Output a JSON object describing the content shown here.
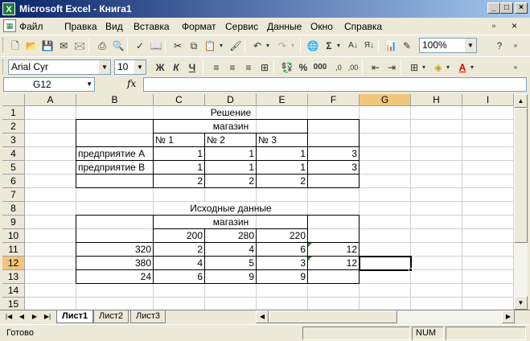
{
  "window": {
    "title": "Microsoft Excel - Книга1"
  },
  "menu": [
    "Файл",
    "Правка",
    "Вид",
    "Вставка",
    "Формат",
    "Сервис",
    "Данные",
    "Окно",
    "Справка"
  ],
  "toolbar": {
    "zoom": "100%",
    "font_name": "Arial Cyr",
    "font_size": "10",
    "sigma": "Σ",
    "bold": "Ж",
    "italic": "К",
    "underline": "Ч",
    "percent": "%",
    "thousands": "000"
  },
  "formula_bar": {
    "name_box": "G12",
    "fx": "fx",
    "content": ""
  },
  "columns": [
    "A",
    "B",
    "C",
    "D",
    "E",
    "F",
    "G",
    "H",
    "I"
  ],
  "rows": [
    "1",
    "2",
    "3",
    "4",
    "5",
    "6",
    "7",
    "8",
    "9",
    "10",
    "11",
    "12",
    "13",
    "14",
    "15"
  ],
  "cells": {
    "C1": "Решение",
    "C2": "магазин",
    "C3": "№ 1",
    "D3": "№ 2",
    "E3": "№ 3",
    "B4": "предприятие А",
    "C4": "1",
    "D4": "1",
    "E4": "1",
    "F4": "3",
    "B5": "предприятие В",
    "C5": "1",
    "D5": "1",
    "E5": "1",
    "F5": "3",
    "C6": "2",
    "D6": "2",
    "E6": "2",
    "C8": "Исходные данные",
    "C9": "магазин",
    "C10": "200",
    "D10": "280",
    "E10": "220",
    "B11": "320",
    "C11": "2",
    "D11": "4",
    "E11": "6",
    "F11": "12",
    "B12": "380",
    "C12": "4",
    "D12": "5",
    "E12": "3",
    "F12": "12",
    "B13": "24",
    "C13": "6",
    "D13": "9",
    "E13": "9"
  },
  "sheets": [
    "Лист1",
    "Лист2",
    "Лист3"
  ],
  "active_sheet": "Лист1",
  "status": {
    "ready": "Готово",
    "num": "NUM"
  },
  "colors": {
    "title_start": "#0a246a",
    "title_end": "#a6caf0",
    "active_header": "#f0c77a",
    "error_triangle": "#2e8b2e"
  }
}
